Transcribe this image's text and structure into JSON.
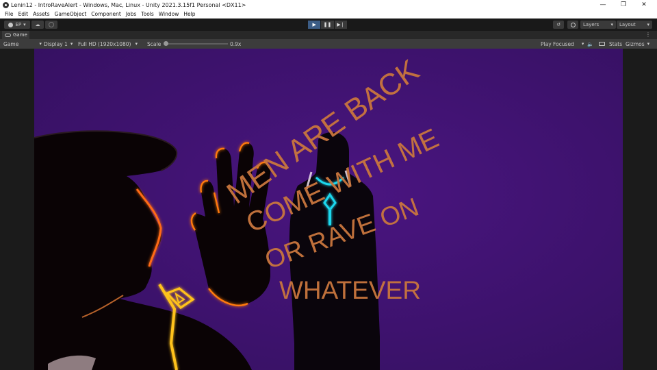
{
  "window": {
    "title": "Lenin12 - IntroRaveAlert - Windows, Mac, Linux - Unity 2021.3.15f1 Personal <DX11>",
    "controls": {
      "minimize": "—",
      "maximize": "❐",
      "close": "✕"
    }
  },
  "menu": [
    "File",
    "Edit",
    "Assets",
    "GameObject",
    "Component",
    "Jobs",
    "Tools",
    "Window",
    "Help"
  ],
  "toolbar": {
    "account_label": "EP",
    "layers_label": "Layers",
    "layout_label": "Layout"
  },
  "tab": {
    "label": "Game"
  },
  "gamebar": {
    "mode": "Game",
    "display": "Display 1",
    "resolution": "Full HD (1920x1080)",
    "scale_label": "Scale",
    "scale_value": "0.9x",
    "play_focused": "Play Focused",
    "stats": "Stats",
    "gizmos": "Gizmos"
  },
  "scene_text": {
    "line1": "MEN ARE BACK",
    "line2": "COME WITH ME",
    "line3": "OR RAVE ON",
    "line4": "WHATEVER"
  },
  "colors": {
    "background_purple": "#3e1170",
    "text_orange": "#c9763e",
    "neon_orange": "#ff7a10",
    "neon_yellow": "#ffc21a",
    "neon_cyan": "#1ed8ee",
    "play_active": "#3c5d86"
  }
}
